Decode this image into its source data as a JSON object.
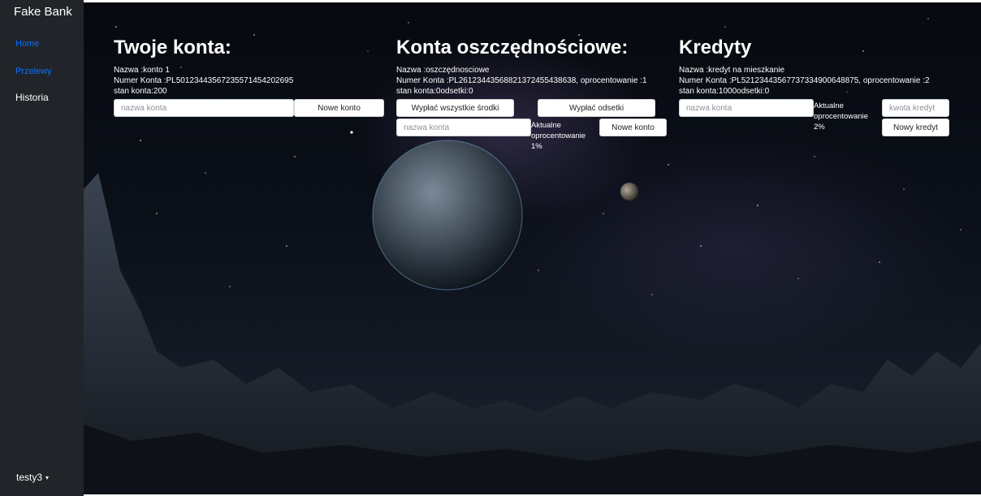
{
  "brand": "Fake Bank",
  "nav": {
    "home": "Home",
    "przelewy": "Przelewy",
    "historia": "Historia"
  },
  "user": {
    "name": "testy3",
    "caret": "▾"
  },
  "accounts": {
    "title": "Twoje konta:",
    "lines": [
      "Nazwa :konto 1",
      "Numer Konta :PL50123443567235571454202695",
      "stan konta:200"
    ],
    "input_placeholder": "nazwa konta",
    "button_new": "Nowe konto"
  },
  "savings": {
    "title": "Konta oszczędnościowe:",
    "lines": [
      "Nazwa :oszczędnosciowe",
      "Numer Konta :PL26123443568821372455438638, oprocentowanie :1",
      "stan konta:0odsetki:0"
    ],
    "button_withdraw_all": "Wypłać wszystkie środki",
    "button_withdraw_interest": "Wypłać odsetki",
    "input_placeholder": "nazwa konta",
    "rate_label_1": "Aktualne",
    "rate_label_2": "oprocentowanie",
    "rate_value": "1%",
    "button_new": "Nowe konto"
  },
  "credits": {
    "title": "Kredyty",
    "lines": [
      "Nazwa :kredyt na mieszkanie",
      "Numer Konta :PL52123443567737334900648875, oprocentowanie :2",
      "stan konta:1000odsetki:0"
    ],
    "input_placeholder": "nazwa konta",
    "rate_label_1": "Aktualne",
    "rate_label_2": "oprocentowanie",
    "rate_value": "2%",
    "amount_placeholder": "kwota kredyt",
    "button_new": "Nowy kredyt"
  }
}
